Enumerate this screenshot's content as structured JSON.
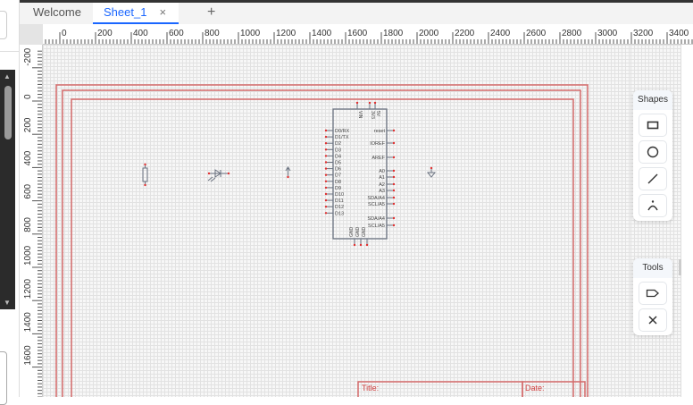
{
  "tabs": [
    {
      "label": "Welcome",
      "active": false
    },
    {
      "label": "Sheet_1",
      "active": true,
      "close": "×"
    }
  ],
  "add_tab": "+",
  "ruler": {
    "h_labels": [
      "0",
      "200",
      "400",
      "600",
      "800",
      "1000",
      "1200",
      "1400",
      "1600",
      "1800",
      "2000",
      "2200",
      "2400",
      "2600",
      "2800",
      "3000",
      "3200",
      "3400"
    ],
    "v_labels": [
      "-200",
      "0",
      "200",
      "400",
      "600",
      "800",
      "1000",
      "1200",
      "1400",
      "1600"
    ]
  },
  "shapes_panel": {
    "title": "Shapes",
    "tools": [
      "rectangle-icon",
      "circle-icon",
      "line-icon",
      "arc-icon"
    ]
  },
  "tools_panel": {
    "title": "Tools",
    "tools": [
      "net-label-icon",
      "no-connect-icon"
    ]
  },
  "title_block": {
    "title_label": "Title:",
    "date_label": "Date:"
  },
  "arduino": {
    "top_pins": [
      "VIN",
      "3V3",
      "5V"
    ],
    "left_pins": [
      "D0/RX",
      "D1/TX",
      "D2",
      "D3",
      "D4",
      "D5",
      "D6",
      "D7",
      "D8",
      "D9",
      "D10",
      "D11",
      "D12",
      "D13"
    ],
    "right_pins": [
      "reset",
      "IOREF",
      "AREF",
      "A0",
      "A1",
      "A2",
      "A3",
      "SDA/A4",
      "SCL/A5",
      "SDA/A4",
      "SCL/A5"
    ],
    "bottom_pins": [
      "GND",
      "GND",
      "GND"
    ]
  },
  "colors": {
    "frame": "#d46a6a",
    "pin": "#e03030",
    "component": "#6a7280",
    "accent": "#1a66ff"
  }
}
